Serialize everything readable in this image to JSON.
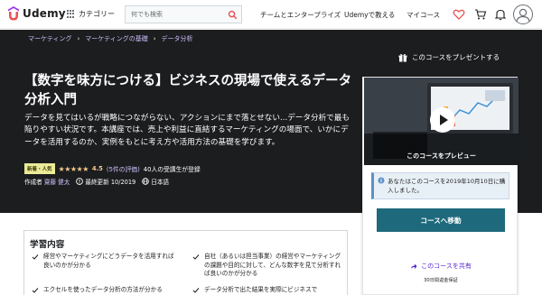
{
  "topnav": {
    "logo_text": "Udemy",
    "categories_label": "カテゴリー",
    "search_placeholder": "何でも検索",
    "business_link": "チームとエンタープライズ",
    "teach_link": "Udemyで教える",
    "my_courses_link": "マイコース"
  },
  "breadcrumb": [
    "マーケティング",
    "マーケティングの基礎",
    "データ分析"
  ],
  "gift_label": "このコースをプレゼントする",
  "course": {
    "title": "【数字を味方につける】ビジネスの現場で使えるデータ分析入門",
    "subtitle": "データを見てはいるが戦略につながらない、アクションにまで落とせない...データ分析で最も陥りやすい状況です。本講座では、売上や利益に直結するマーケティングの場面で、いかにデータを活用するのか、実例をもとに考え方や活用方法の基礎を学びます。",
    "badge": "新着・人気",
    "stars": "★★★★★",
    "rating": "4.5",
    "review_count": "(5件の評価)",
    "students": "40人の受講生が登録",
    "author_prefix": "作成者",
    "author_name": "齋藤 健太",
    "updated": "最終更新 10/2019",
    "language": "日本語"
  },
  "card": {
    "preview_label": "このコースをプレビュー",
    "notice_text": "あなたはこのコースを2019年10月10日に購入しました。",
    "go_button": "コースへ移動",
    "share_label": "このコースを共有",
    "guarantee": "30日間返金保証"
  },
  "learn": {
    "title": "学習内容",
    "items": [
      "経営やマーケティングにどうデータを活用すれば良いのかが分かる",
      "自社（あるいは担当事業）の経営やマーケティングの課題や目的に対して、どんな数字を見て分析すれば良いのかが分かる",
      "エクセルを使ったデータ分析の方法が分かる",
      "データ分析で出た結果を実際にビジネスで"
    ]
  },
  "colors": {
    "hero_bg": "#1c1d1f",
    "link_purple": "#cec0fc",
    "star_gold": "#f3ca8c",
    "primary_button": "#1e6a7c",
    "udemy_red": "#ec5252"
  }
}
